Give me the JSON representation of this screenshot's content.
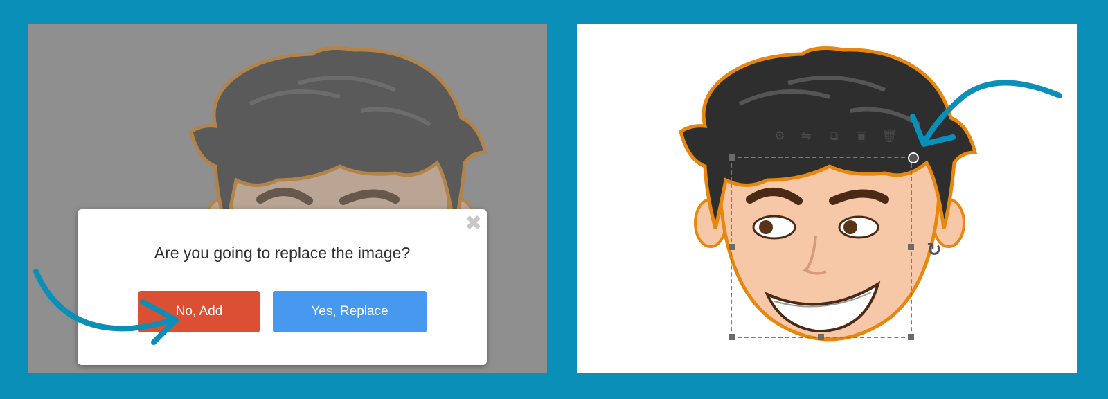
{
  "colors": {
    "background": "#0a8fb8",
    "arrow": "#0a8fb8",
    "no_button": "#db4f33",
    "yes_button": "#4799f0",
    "hair": "#2e2e2e",
    "hair_outline": "#e8870e",
    "skin": "#f6c8a8"
  },
  "left_panel": {
    "modal": {
      "close_icon": "close-icon",
      "question": "Are you going to replace the image?",
      "no_button_label": "No, Add",
      "yes_button_label": "Yes, Replace"
    }
  },
  "right_panel": {
    "toolbar_icons": [
      "gear-icon",
      "flip-icon",
      "duplicate-icon",
      "layers-icon",
      "trash-icon"
    ],
    "rotate_icon": "rotate-icon"
  }
}
